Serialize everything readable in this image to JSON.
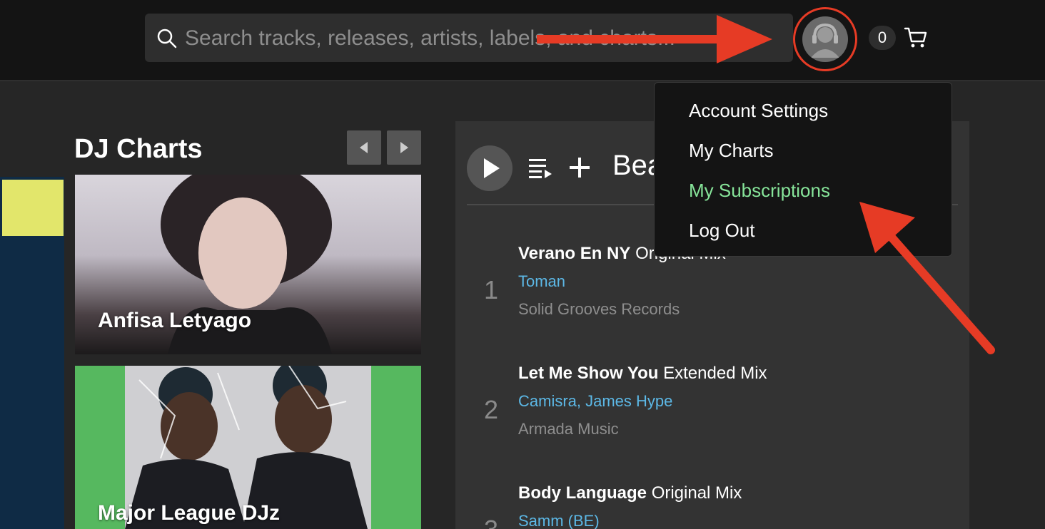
{
  "search": {
    "placeholder": "Search tracks, releases, artists, labels, and charts..."
  },
  "header": {
    "cart_count": "0"
  },
  "account_menu": {
    "items": [
      {
        "label": "Account Settings"
      },
      {
        "label": "My Charts"
      },
      {
        "label": "My Subscriptions",
        "highlighted": true
      },
      {
        "label": "Log Out"
      }
    ]
  },
  "dj_charts": {
    "title": "DJ Charts",
    "cards": [
      {
        "name": "Anfisa Letyago"
      },
      {
        "name": "Major League DJz"
      }
    ]
  },
  "chart": {
    "name": "Bea",
    "tracks": [
      {
        "rank": "1",
        "title": "Verano En NY",
        "mix": "Original Mix",
        "artist": "Toman",
        "label": "Solid Grooves Records"
      },
      {
        "rank": "2",
        "title": "Let Me Show You",
        "mix": "Extended Mix",
        "artist": "Camisra, James Hype",
        "label": "Armada Music"
      },
      {
        "rank": "3",
        "title": "Body Language",
        "mix": "Original Mix",
        "artist": "Samm (BE)",
        "label": ""
      }
    ]
  },
  "colors": {
    "accent_green": "#87e59a",
    "artist_blue": "#5cb8e6",
    "annotation_red": "#e63b25"
  },
  "icons": [
    "search-icon",
    "avatar-icon",
    "cart-icon",
    "play-icon",
    "queue-icon",
    "add-icon",
    "chevron-left-icon",
    "chevron-right-icon"
  ]
}
